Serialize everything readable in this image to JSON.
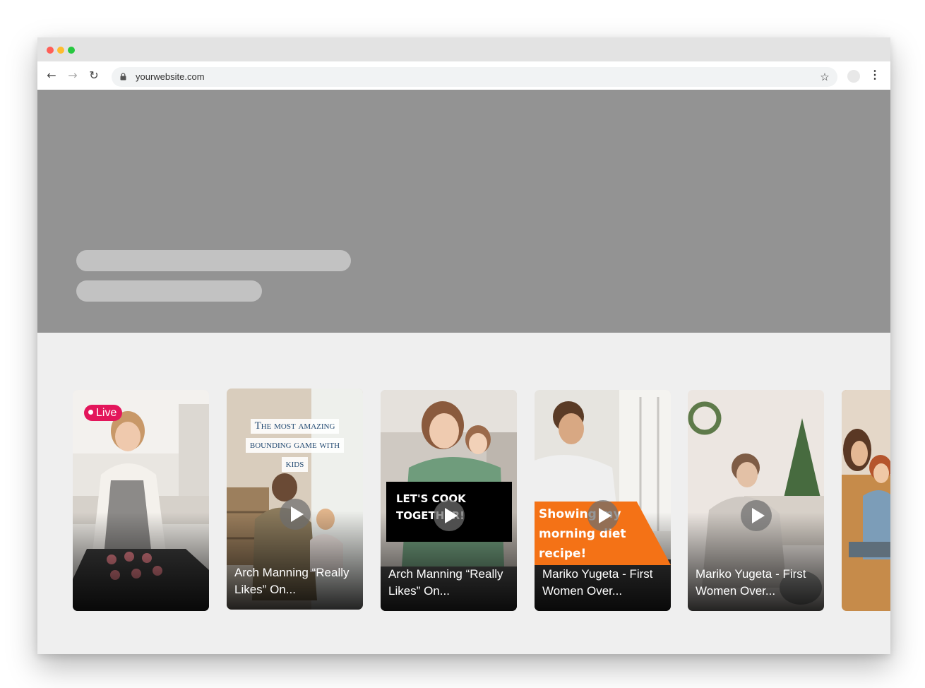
{
  "browser": {
    "url": "yourwebsite.com"
  },
  "cards": [
    {
      "badge": "Live",
      "caption": ""
    },
    {
      "overlay_lines": [
        "The most amazing",
        "bounding game with",
        "kids"
      ],
      "caption": "Arch Manning “Really Likes” On..."
    },
    {
      "overlay_text": "Let's cook together!",
      "caption": "Arch Manning “Really Likes” On..."
    },
    {
      "overlay_text": "Showing my morning diet recipe!",
      "caption": "Mariko Yugeta - First Women Over..."
    },
    {
      "caption": "Mariko Yugeta - First Women Over..."
    },
    {
      "caption": ""
    }
  ],
  "colors": {
    "hero_background": "#939393",
    "live_badge": "#e3165b",
    "orange_overlay": "#f47216"
  },
  "icons": [
    "back-arrow-icon",
    "forward-arrow-icon",
    "reload-icon",
    "lock-icon",
    "star-icon",
    "profile-icon",
    "more-menu-icon",
    "play-icon"
  ]
}
